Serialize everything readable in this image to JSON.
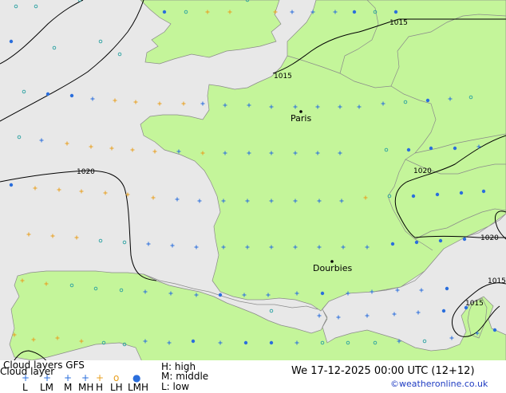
{
  "map": {
    "cities": [
      {
        "name": "Paris"
      },
      {
        "name": "Dourbies"
      }
    ],
    "isobar_labels": [
      "1015",
      "1015",
      "1020",
      "1020",
      "1020",
      "1015",
      "1015"
    ],
    "colors": {
      "sea": "#e8e8e8",
      "land": "#c4f59a",
      "coast": "#8a8a8a",
      "isobar": "#000000",
      "high_cloud": "#2a6edc",
      "middle_cloud": "#e8a020",
      "low_cloud": "#2a6edc"
    }
  },
  "footer": {
    "title_line1": "Cloud layers  GFS",
    "title_line2": "Cloud layer",
    "legend_codes": [
      "L",
      "LM",
      "M",
      "MH",
      "H",
      "LH",
      "LMH"
    ],
    "legend_symbols": [
      "+",
      "+",
      "+",
      "+",
      "+",
      "o",
      "o",
      "●"
    ],
    "key_high": "H: high",
    "key_middle": "M: middle",
    "key_low": "L: low",
    "datetime": "We 17-12-2025 00:00 UTC (12+12)",
    "credit": "©weatheronline.co.uk"
  }
}
